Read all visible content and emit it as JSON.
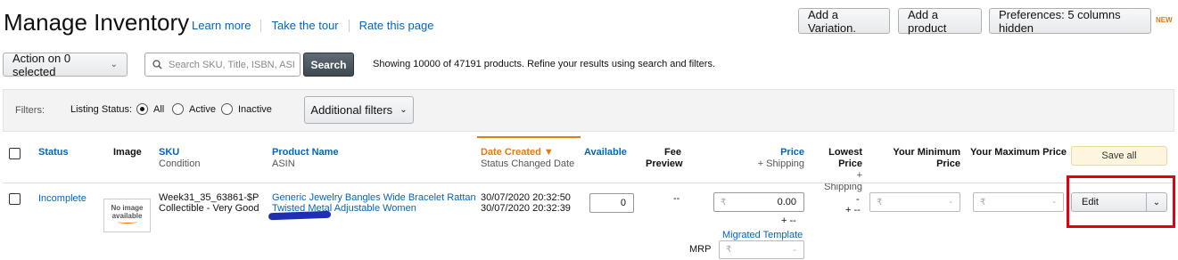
{
  "header": {
    "title": "Manage Inventory",
    "links": [
      "Learn more",
      "Take the tour",
      "Rate this page"
    ],
    "buttons": {
      "add_variation": "Add a Variation.",
      "add_product": "Add a product",
      "preferences": "Preferences: 5 columns hidden"
    },
    "new_badge": "NEW"
  },
  "toolbar": {
    "action_select": "Action on 0 selected",
    "search_placeholder": "Search SKU, Title, ISBN, ASI",
    "search_button": "Search",
    "showing_text": "Showing 10000 of 47191 products. Refine your results using search and filters."
  },
  "filters": {
    "label": "Filters:",
    "listing_status_label": "Listing Status:",
    "options": [
      "All",
      "Active",
      "Inactive"
    ],
    "selected": "All",
    "additional_filters": "Additional filters"
  },
  "table": {
    "headers": {
      "status": "Status",
      "image": "Image",
      "sku": "SKU",
      "condition": "Condition",
      "product_name": "Product Name",
      "asin": "ASIN",
      "date_created": "Date Created",
      "status_changed": "Status Changed Date",
      "available": "Available",
      "fee_preview_1": "Fee",
      "fee_preview_2": "Preview",
      "price": "Price",
      "plus_shipping": "+ Shipping",
      "lowest_price_1": "Lowest",
      "lowest_price_2": "Price",
      "lowest_shipping": "+ Shipping",
      "min_price_1": "Your Minimum",
      "min_price_2": "Price",
      "max_price": "Your Maximum Price",
      "save_all": "Save all"
    },
    "rows": [
      {
        "status": "Incomplete",
        "image_text_1": "No image",
        "image_text_2": "available",
        "sku": "Week31_35_63861-$P",
        "condition": "Collectible - Very Good",
        "product_name_1": "Generic Jewelry Bangles Wide Bracelet Rattan",
        "product_name_2": "Twisted Metal Adjustable Women",
        "date_created": "30/07/2020 20:32:50",
        "status_changed": "30/07/2020 20:32:39",
        "available": "0",
        "fee_preview": "--",
        "currency": "₹",
        "price": "0.00",
        "shipping": "+ --",
        "migrated_template": "Migrated Template",
        "mrp_label": "MRP",
        "mrp_value": "-",
        "lowest_price": "-",
        "lowest_shipping": "+ --",
        "min_price": "-",
        "max_price": "-",
        "edit": "Edit"
      }
    ]
  }
}
